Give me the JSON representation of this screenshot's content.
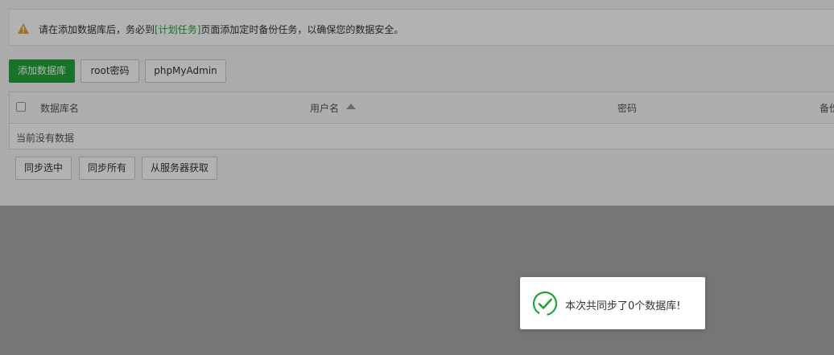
{
  "notice": {
    "text_before": "请在添加数据库后，务必到",
    "link": "[计划任务]",
    "text_after": "页面添加定时备份任务，以确保您的数据安全。"
  },
  "toolbar": {
    "add_db": "添加数据库",
    "root_pwd": "root密码",
    "phpmyadmin": "phpMyAdmin"
  },
  "table": {
    "columns": {
      "name": "数据库名",
      "user": "用户名",
      "password": "密码",
      "backup": "备份"
    },
    "empty": "当前没有数据"
  },
  "actions": {
    "sync_selected": "同步选中",
    "sync_all": "同步所有",
    "fetch_server": "从服务器获取"
  },
  "toast": {
    "message": "本次共同步了0个数据库!"
  },
  "colors": {
    "accent": "#20a53a",
    "warning": "#e8a23a"
  }
}
